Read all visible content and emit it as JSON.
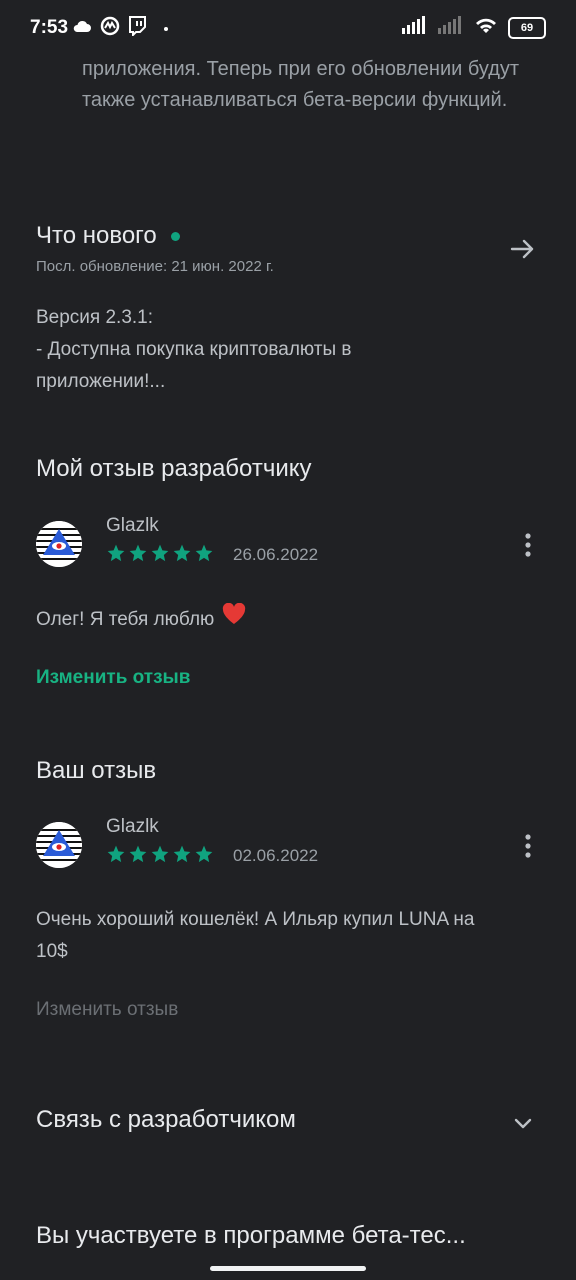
{
  "status_bar": {
    "time": "7:53",
    "battery": "69"
  },
  "beta_info": {
    "text": "приложения. Теперь при его обновлении будут также устанавливаться бета-версии функций."
  },
  "whats_new": {
    "title": "Что нового",
    "updated": "Посл. обновление: 21 июн. 2022 г.",
    "notes": [
      "Версия 2.3.1:",
      "- Доступна покупка криптовалюты в",
      "приложении!..."
    ]
  },
  "dev_review": {
    "title": "Мой отзыв разработчику",
    "reviewer": "Glazlk",
    "date": "26.06.2022",
    "rating": 5,
    "text": "Олег! Я тебя люблю",
    "edit_label": "Изменить отзыв"
  },
  "your_review": {
    "title": "Ваш отзыв",
    "reviewer": "Glazlk",
    "date": "02.06.2022",
    "rating": 5,
    "text_line1": "Очень хороший кошелёк! А Ильяр купил LUNA на",
    "text_line2": "10$",
    "edit_label": "Изменить отзыв"
  },
  "contact": {
    "title": "Связь с разработчиком"
  },
  "beta_program": {
    "title": "Вы участвуете в программе бета-тес..."
  },
  "colors": {
    "background": "#202124",
    "accent": "#18b383",
    "star": "#10a37f"
  }
}
